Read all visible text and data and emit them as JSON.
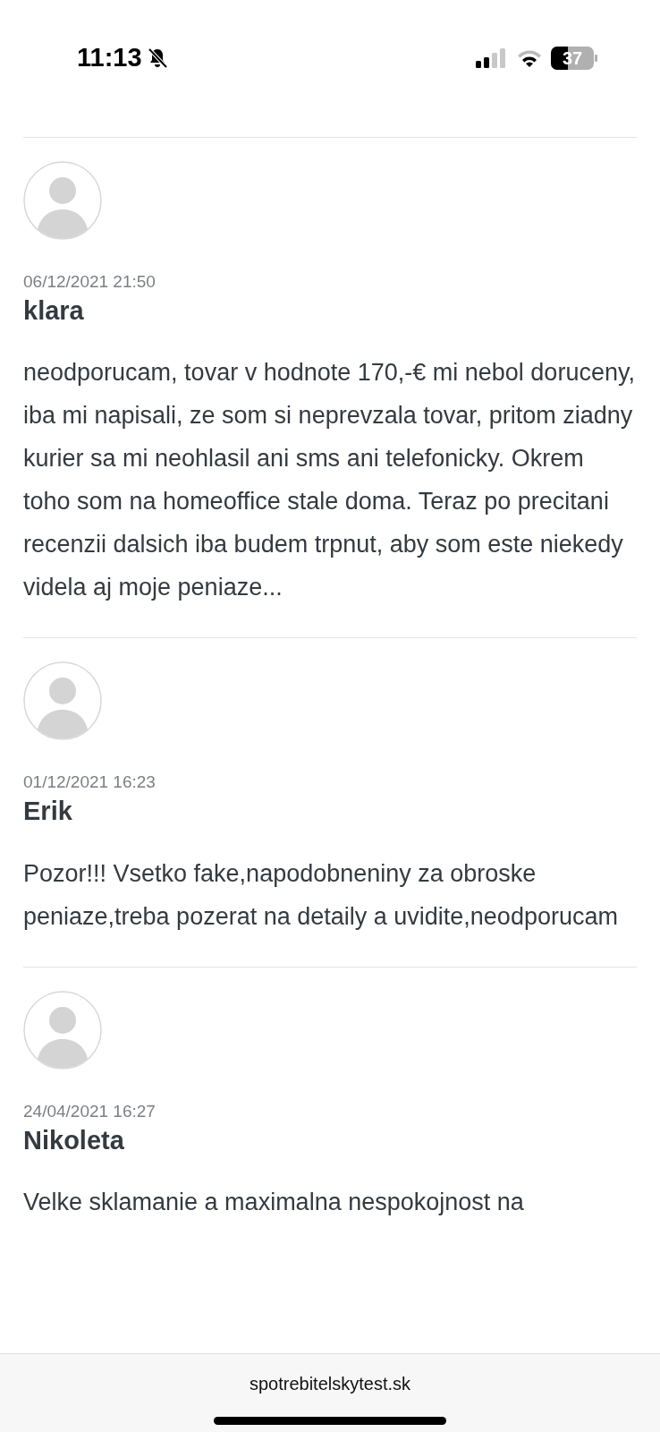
{
  "status_bar": {
    "time": "11:13",
    "battery": "37"
  },
  "reviews": [
    {
      "date": "06/12/2021 21:50",
      "author": "klara",
      "text": "neodporucam, tovar v hodnote 170,-€ mi nebol doruceny, iba mi napisali, ze som si neprevzala tovar, pritom ziadny kurier sa mi neohlasil ani sms ani telefonicky. Okrem toho som na homeoffice stale doma. Teraz po precitani recenzii dalsich iba budem trpnut, aby som este niekedy videla aj moje peniaze..."
    },
    {
      "date": "01/12/2021 16:23",
      "author": "Erik",
      "text": "Pozor!!! Vsetko fake,napodobneniny za obroske peniaze,treba pozerat na detaily a uvidite,neodporucam"
    },
    {
      "date": "24/04/2021 16:27",
      "author": "Nikoleta",
      "text": "Velke sklamanie a maximalna nespokojnost na"
    }
  ],
  "browser": {
    "url": "spotrebitelskytest.sk"
  }
}
